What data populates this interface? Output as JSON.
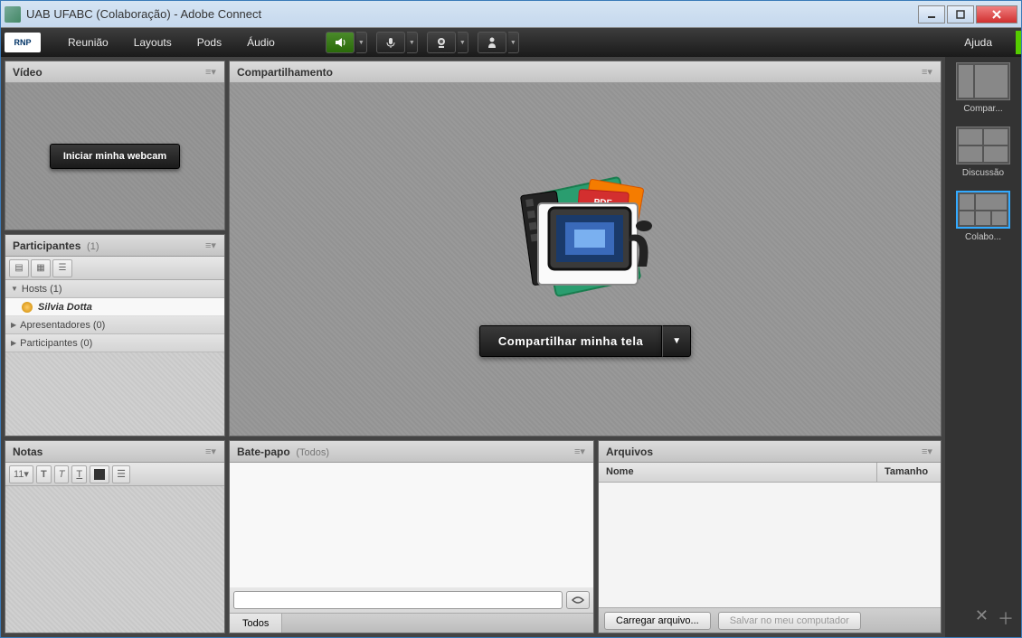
{
  "window": {
    "title": "UAB UFABC (Colaboração) - Adobe Connect"
  },
  "menubar": {
    "logo": "RNP",
    "items": [
      "Reunião",
      "Layouts",
      "Pods",
      "Áudio"
    ],
    "help": "Ajuda"
  },
  "pods": {
    "video": {
      "title": "Vídeo",
      "button": "Iniciar minha webcam"
    },
    "participants": {
      "title": "Participantes",
      "count": "(1)",
      "groups": {
        "hosts": "Hosts (1)",
        "presenters": "Apresentadores (0)",
        "participants": "Participantes (0)"
      },
      "users": {
        "host1": "Silvia Dotta"
      }
    },
    "share": {
      "title": "Compartilhamento",
      "button": "Compartilhar minha tela"
    },
    "notes": {
      "title": "Notas",
      "fontsize": "11"
    },
    "chat": {
      "title": "Bate-papo",
      "subtitle": "(Todos)",
      "tab": "Todos"
    },
    "files": {
      "title": "Arquivos",
      "col_name": "Nome",
      "col_size": "Tamanho",
      "upload": "Carregar arquivo...",
      "save": "Salvar no meu computador"
    }
  },
  "layouts": {
    "l1": "Compar...",
    "l2": "Discussão",
    "l3": "Colabo..."
  }
}
